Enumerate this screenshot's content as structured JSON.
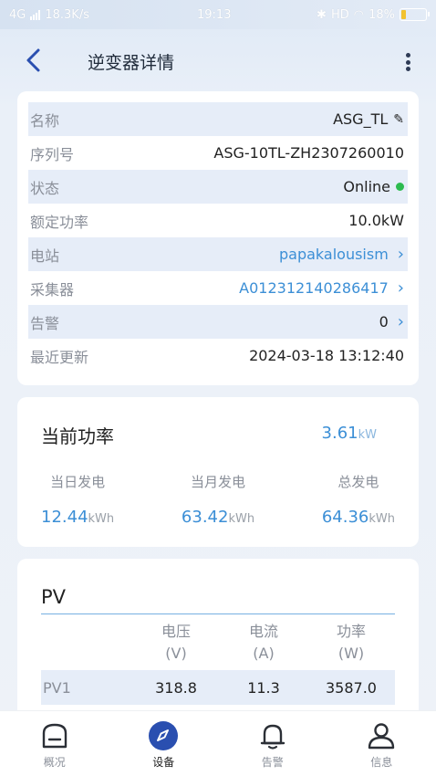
{
  "status_bar": {
    "network": "4G",
    "speed": "18.3K/s",
    "time": "19:13",
    "hd": "HD",
    "battery": "18%",
    "battery_level": 0.18
  },
  "header": {
    "title": "逆变器详情"
  },
  "info": {
    "rows": [
      {
        "key": "名称",
        "value": "ASG_TL"
      },
      {
        "key": "序列号",
        "value": "ASG-10TL-ZH2307260010"
      },
      {
        "key": "状态",
        "value": "Online"
      },
      {
        "key": "额定功率",
        "value": "10.0kW"
      },
      {
        "key": "电站",
        "value": "papakalousism"
      },
      {
        "key": "采集器",
        "value": "A01231214028641​7"
      },
      {
        "key": "告警",
        "value": "0"
      },
      {
        "key": "最近更新",
        "value": "2024-03-18 13:12:40"
      }
    ]
  },
  "power": {
    "title": "当前功率",
    "value": "3.61",
    "unit": "kW",
    "stats": [
      {
        "label": "当日发电",
        "value": "12.44",
        "unit": "kWh"
      },
      {
        "label": "当月发电",
        "value": "63.42",
        "unit": "kWh"
      },
      {
        "label": "总发电",
        "value": "64.36",
        "unit": "kWh"
      }
    ]
  },
  "pv": {
    "title": "PV",
    "columns": [
      {
        "name": "电压",
        "unit": "(V)"
      },
      {
        "name": "电流",
        "unit": "(A)"
      },
      {
        "name": "功率",
        "unit": "(W)"
      }
    ],
    "rows": [
      {
        "name": "PV1",
        "values": [
          "318.8",
          "11.3",
          "3587.0"
        ]
      }
    ]
  },
  "tabs": [
    {
      "label": "概况",
      "icon": "overview-icon"
    },
    {
      "label": "设备",
      "icon": "compass-icon"
    },
    {
      "label": "告警",
      "icon": "bell-icon"
    },
    {
      "label": "信息",
      "icon": "user-icon"
    }
  ],
  "colors": {
    "accent": "#3c8fd6",
    "online": "#2dbb4f",
    "row_shade": "#e6edf8"
  }
}
